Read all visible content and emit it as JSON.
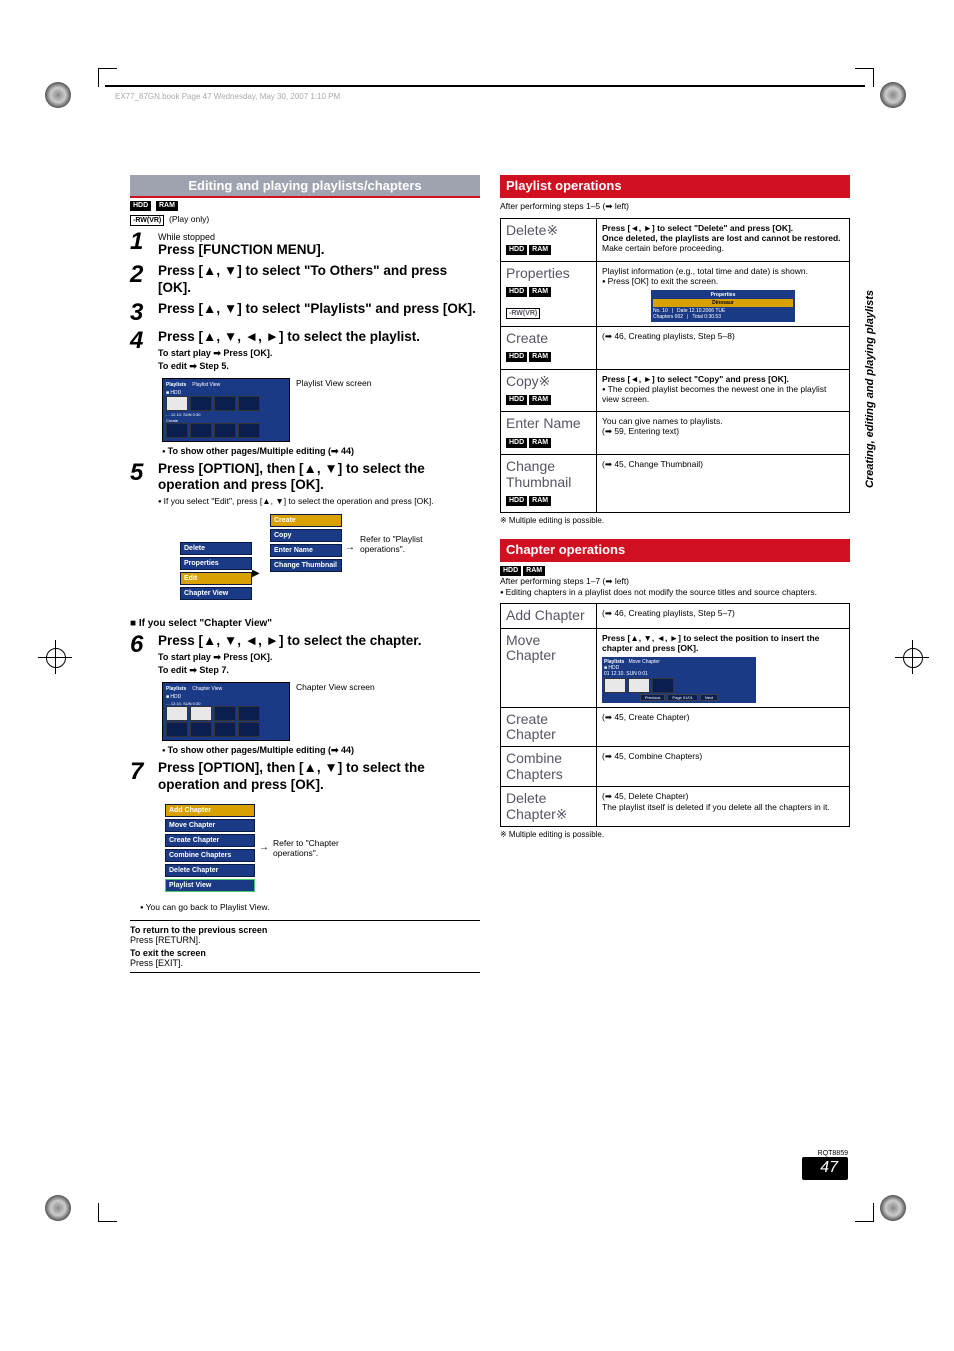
{
  "header_fileinfo": "EX77_87GN.book  Page 47  Wednesday, May 30, 2007  1:10 PM",
  "side_tab": "Creating, editing and playing playlists",
  "footer": {
    "code": "RQT8859",
    "page": "47"
  },
  "left": {
    "heading": "Editing and playing playlists/chapters",
    "badges_top": [
      "HDD",
      "RAM"
    ],
    "badge_outline": "-RW(VR)",
    "play_only": "(Play only)",
    "steps": {
      "1": {
        "pre": "While stopped",
        "title": "Press [FUNCTION MENU]."
      },
      "2": {
        "title": "Press [▲, ▼] to select \"To Others\" and press [OK]."
      },
      "3": {
        "title": "Press [▲, ▼] to select \"Playlists\" and press [OK]."
      },
      "4": {
        "title": "Press [▲, ▼, ◄, ►] to select the playlist.",
        "sub1": "To start play ➡ Press [OK].",
        "sub2": "To edit ➡ Step 5.",
        "screen_caption": "Playlist View screen",
        "show_note": "To show other pages/Multiple editing (➡ 44)"
      },
      "5": {
        "title": "Press [OPTION], then [▲, ▼] to select the operation and press [OK].",
        "note": "If you select \"Edit\", press [▲, ▼] to select the operation and press [OK].",
        "refer": "Refer to \"Playlist operations\"."
      },
      "6": {
        "header": "■ If you select \"Chapter View\"",
        "title": "Press [▲, ▼, ◄, ►] to select the chapter.",
        "sub1": "To start play ➡ Press [OK].",
        "sub2": "To edit ➡ Step 7.",
        "screen_caption": "Chapter View screen",
        "show_note": "To show other pages/Multiple editing (➡ 44)"
      },
      "7": {
        "title": "Press [OPTION], then [▲, ▼] to select the operation and press [OK].",
        "refer": "Refer to \"Chapter operations\".",
        "goback": "You can go back to Playlist View."
      }
    },
    "option_menu_left": [
      "Delete",
      "Properties",
      "Edit",
      "Chapter View"
    ],
    "option_menu_right": [
      "Create",
      "Copy",
      "Enter Name",
      "Change Thumbnail"
    ],
    "chapter_menu": [
      "Add Chapter",
      "Move Chapter",
      "Create Chapter",
      "Combine Chapters",
      "Delete Chapter",
      "Playlist View"
    ],
    "return_block": {
      "t1": "To return to the previous screen",
      "l1": "Press [RETURN].",
      "t2": "To exit the screen",
      "l2": "Press [EXIT]."
    },
    "mini_pv": {
      "title1": "Playlists",
      "title2": "Playlist View",
      "sub": "■ HDD",
      "ts": "- - 12.10. SUN 0:30",
      "cap": "Create"
    },
    "mini_cv": {
      "title1": "Playlists",
      "title2": "Chapter View",
      "sub": "■ HDD",
      "ts": "- - 12.10. SUN  0:30"
    }
  },
  "right": {
    "playlist_heading": "Playlist operations",
    "after_playlist": "After performing steps 1–5 (➡ left)",
    "rows_playlist": {
      "delete": {
        "name": "Delete※",
        "badges": [
          "HDD",
          "RAM"
        ],
        "b1": "Press [◄, ►] to select \"Delete\" and press [OK].",
        "b2": "Once deleted, the playlists are lost and cannot be restored.",
        "b3": "Make certain before proceeding."
      },
      "properties": {
        "name": "Properties",
        "badges": [
          "HDD",
          "RAM"
        ],
        "badge_outline": "-RW(VR)",
        "b1": "Playlist information (e.g., total time and date) is shown.",
        "b2": "Press [OK] to exit the screen.",
        "pbox": {
          "title": "Properties",
          "pname": "Dinosaur",
          "no": "No.    10",
          "date": "Date  12.10.2006 TUE",
          "ch": "Chapters 002",
          "total": "Total 0:30.53"
        }
      },
      "create": {
        "name": "Create",
        "badges": [
          "HDD",
          "RAM"
        ],
        "b1": "(➡ 46, Creating playlists, Step 5–8)"
      },
      "copy": {
        "name": "Copy※",
        "badges": [
          "HDD",
          "RAM"
        ],
        "b1": "Press [◄, ►] to select \"Copy\" and press [OK].",
        "b2": "The copied playlist becomes the newest one in the playlist view screen."
      },
      "enter": {
        "name": "Enter Name",
        "badges": [
          "HDD",
          "RAM"
        ],
        "b1": "You can give names to playlists.",
        "b2": "(➡ 59, Entering text)"
      },
      "thumb": {
        "name": "Change Thumbnail",
        "badges": [
          "HDD",
          "RAM"
        ],
        "b1": "(➡ 45, Change Thumbnail)"
      }
    },
    "multi_note": "※ Multiple editing is possible.",
    "chapter_heading": "Chapter operations",
    "chapter_badges": [
      "HDD",
      "RAM"
    ],
    "after_chapter": "After performing steps 1–7 (➡ left)",
    "chapter_note": "Editing chapters in a playlist does not modify the source titles and source chapters.",
    "rows_chapter": {
      "add": {
        "name": "Add Chapter",
        "b1": "(➡ 46, Creating playlists, Step 5–7)"
      },
      "move": {
        "name": "Move Chapter",
        "b1": "Press [▲, ▼, ◄, ►] to select the position to insert the chapter and press [OK].",
        "mbox": {
          "title1": "Playlists",
          "title2": "Move Chapter",
          "sub": "■ HDD",
          "ts": "01 12.10. SUN 0:01",
          "btns": [
            "Previous",
            "Page 01/01",
            "Next"
          ]
        }
      },
      "create": {
        "name": "Create Chapter",
        "b1": "(➡ 45, Create Chapter)"
      },
      "combine": {
        "name": "Combine Chapters",
        "b1": "(➡ 45, Combine Chapters)"
      },
      "delete": {
        "name": "Delete Chapter※",
        "b1": "(➡ 45, Delete Chapter)",
        "b2": "The playlist itself is deleted if you delete all the chapters in it."
      }
    }
  }
}
